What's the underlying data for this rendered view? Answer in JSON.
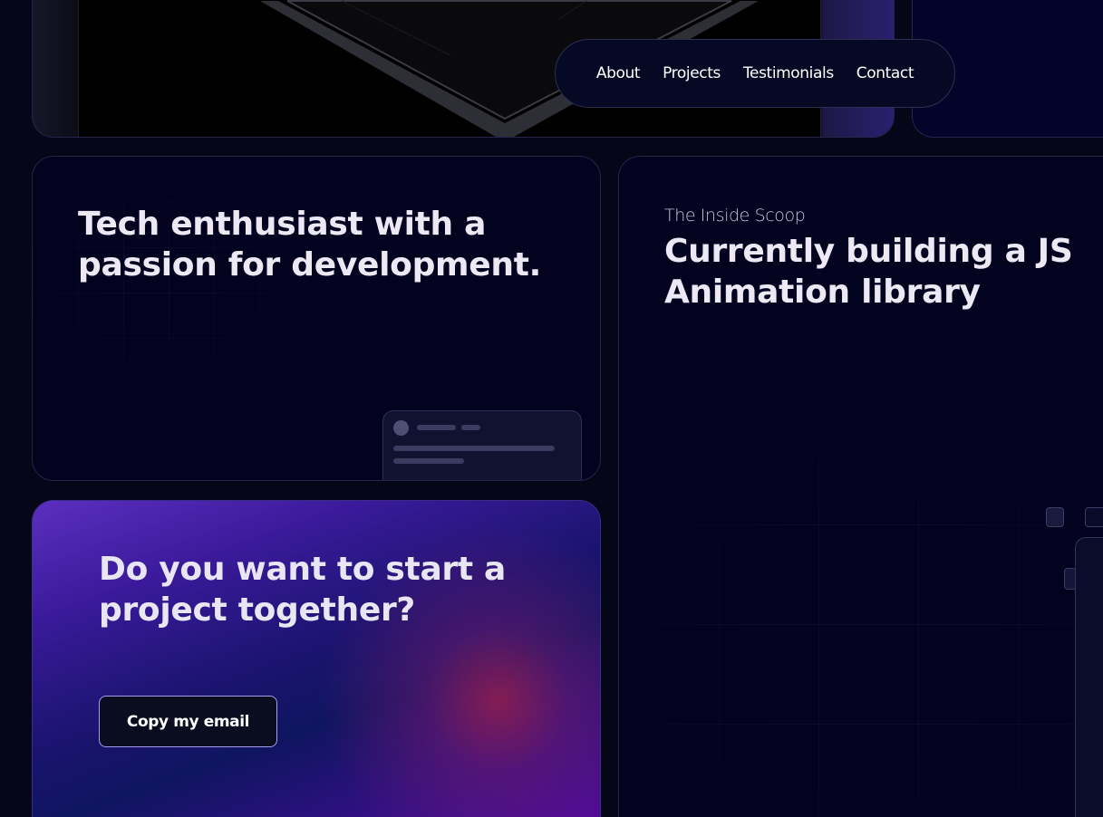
{
  "nav": {
    "items": [
      {
        "label": "About"
      },
      {
        "label": "Projects"
      },
      {
        "label": "Testimonials"
      },
      {
        "label": "Contact"
      }
    ]
  },
  "cards": {
    "tech": {
      "heading": "Tech enthusiast with a passion for development."
    },
    "scoop": {
      "eyebrow": "The Inside Scoop",
      "heading": "Currently building a JS Animation library"
    },
    "cta": {
      "heading": "Do you want to start a project together?",
      "button_label": "Copy my email"
    }
  },
  "colors": {
    "background": "#050718",
    "card": "#03021f",
    "cta_gradient_start": "#5b2fc0",
    "cta_gradient_end": "#5a06a6",
    "text": "#ece9f5"
  }
}
